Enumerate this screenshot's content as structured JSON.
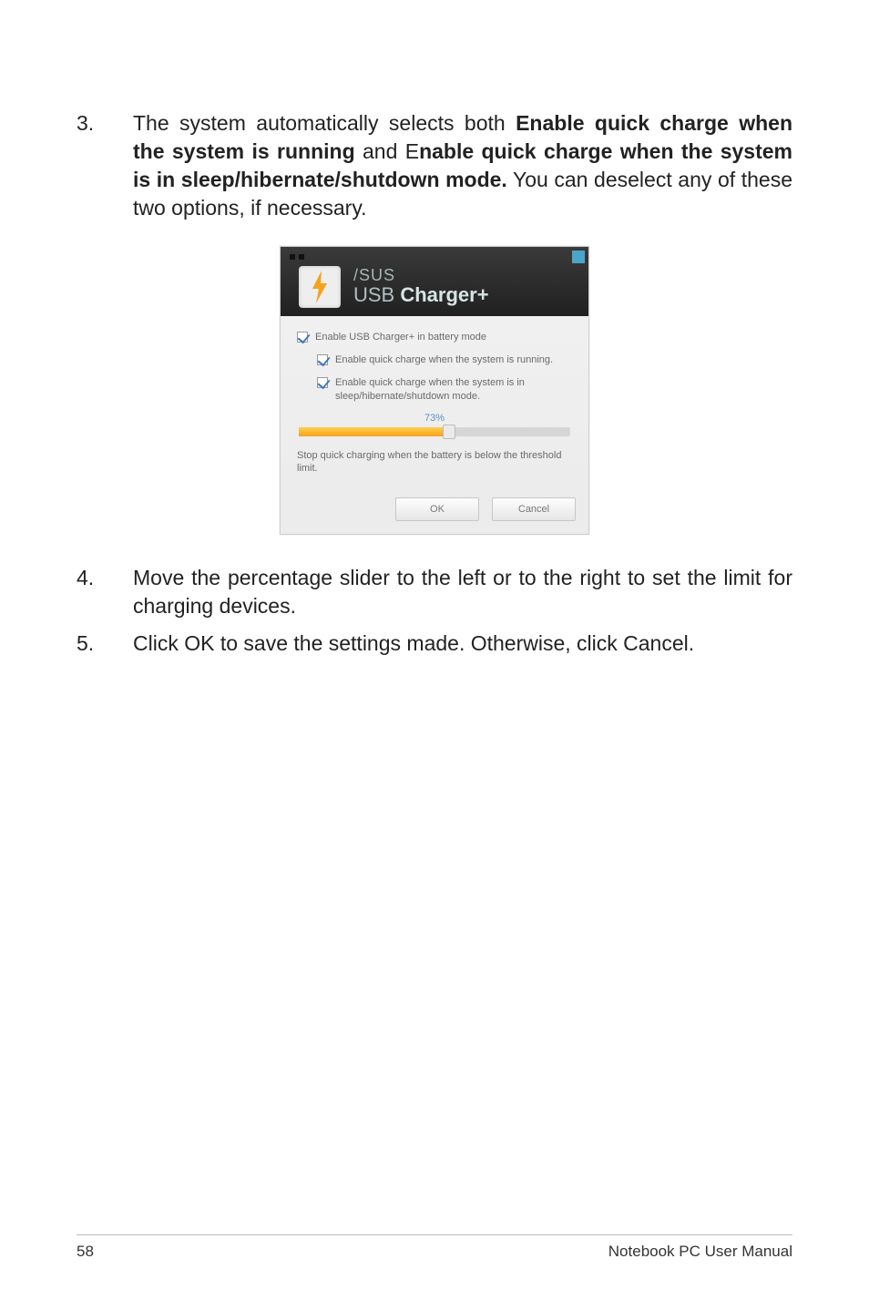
{
  "steps": {
    "s3": {
      "num": "3.",
      "pre": "The system automatically selects both ",
      "bold1": "Enable quick charge when the system is running",
      "mid1": " and E",
      "bold2": "nable quick charge when the system is in sleep/hibernate/shutdown mode.",
      "post": " You can deselect any of these two options, if necessary."
    },
    "s4": {
      "num": "4.",
      "text": "Move the percentage slider to the left or to the right to set the limit for charging devices."
    },
    "s5": {
      "num": "5.",
      "text": "Click OK to save the settings made. Otherwise, click Cancel."
    }
  },
  "dialog": {
    "brand": "/SUS",
    "title_light": "USB ",
    "title_bold": "Charger+",
    "chk_main": "Enable USB Charger+ in battery mode",
    "chk_sub1": "Enable quick charge when the system is running.",
    "chk_sub2": "Enable quick charge when the system is in sleep/hibernate/shutdown mode.",
    "percent": "73%",
    "slider_desc": "Stop quick charging when the battery is below the threshold limit.",
    "ok": "OK",
    "cancel": "Cancel"
  },
  "footer": {
    "page": "58",
    "title": "Notebook PC User Manual"
  }
}
